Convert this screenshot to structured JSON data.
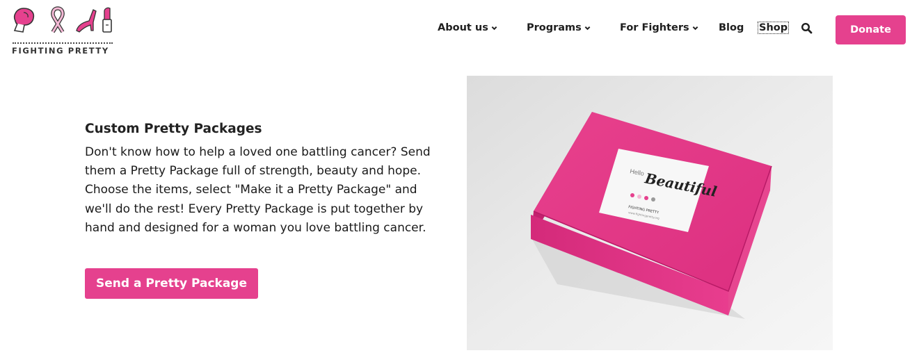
{
  "brand": {
    "logo_text": "FIGHTING PRETTY",
    "accent_color": "#e5418e",
    "icons": [
      "boxing-glove-icon",
      "ribbon-icon",
      "high-heel-icon",
      "lipstick-icon"
    ]
  },
  "nav": {
    "items": [
      {
        "label": "About us",
        "has_dropdown": true
      },
      {
        "label": "Programs",
        "has_dropdown": true
      },
      {
        "label": "For Fighters",
        "has_dropdown": true
      },
      {
        "label": "Blog",
        "has_dropdown": false
      },
      {
        "label": "Shop",
        "has_dropdown": false
      }
    ],
    "search_icon": "search-icon",
    "donate_label": "Donate"
  },
  "main": {
    "heading": "Custom Pretty Packages",
    "description": "Don't know how to help a loved one battling cancer? Send them a Pretty Package full of strength, beauty and hope. Choose the items, select \"Make it a Pretty Package\" and we'll do the rest! Every Pretty Package is put together by hand and designed for a woman you love battling cancer.",
    "cta_label": "Send a Pretty Package",
    "photo": {
      "sticker_small": "Hello",
      "sticker_main": "Beautiful",
      "sticker_footer": "FIGHTING PRETTY",
      "sticker_url": "www.fightingpretty.org"
    }
  }
}
